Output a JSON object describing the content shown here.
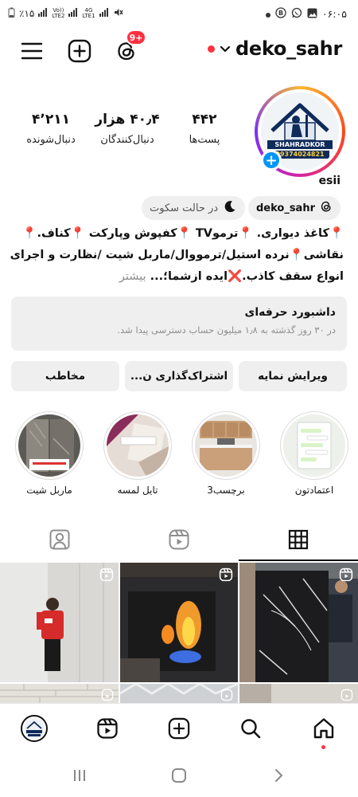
{
  "status_bar": {
    "battery": "٪۱۵",
    "volte1": "Vo))",
    "lte2": "LTE2",
    "net_4g": "4G",
    "lte1": "LTE1",
    "time": "۰۶:۰۵"
  },
  "header": {
    "username": "deko_sahr",
    "notification_badge": "9+"
  },
  "profile": {
    "stats": [
      {
        "value": "۴۴۲",
        "label": "پست‌ها"
      },
      {
        "value": "۴۰٫۴ هزار",
        "label": "دنبال‌کنندگان"
      },
      {
        "value": "۴٬۲۱۱",
        "label": "دنبال‌شونده"
      }
    ],
    "avatar_brand": "SHAHRADKOR",
    "avatar_phone": "09374024821",
    "display_name": "esii"
  },
  "chips": {
    "threads_handle": "deko_sahr",
    "silent_mode": "در حالت سکوت"
  },
  "bio": {
    "line1": "کاغذ دیواری.",
    "line1b": "ترموTV",
    "line1c": "کفپوش وپارکت",
    "line1d": "کناف.",
    "line2a": "نقاشی",
    "line2b": "نرده استیل/ترمووال/ماربل شیت /نظارت و اجرای",
    "line3a": "انواع سقف کاذب.",
    "line3b": "ایده ازشما؛...",
    "more": "بیشتر"
  },
  "dashboard": {
    "title": "داشبورد حرفه‌ای",
    "subtitle": "در ۳۰ روز گذشته به ۱٫۸ میلیون حساب دسترسی پیدا شد."
  },
  "actions": {
    "edit_profile": "ویرایش نمایه",
    "share_profile": "اشتراک‌گذاری ن...",
    "contact": "مخاطب"
  },
  "highlights": [
    {
      "label": "اعتمادتون"
    },
    {
      "label": "برچسب3"
    },
    {
      "label": "تایل لمسه"
    },
    {
      "label": "ماربل شیت"
    }
  ],
  "colors": {
    "accent_blue": "#0095f6",
    "badge_red": "#ff3040",
    "chip_bg": "#efefef",
    "muted_text": "#8e8e8e"
  }
}
